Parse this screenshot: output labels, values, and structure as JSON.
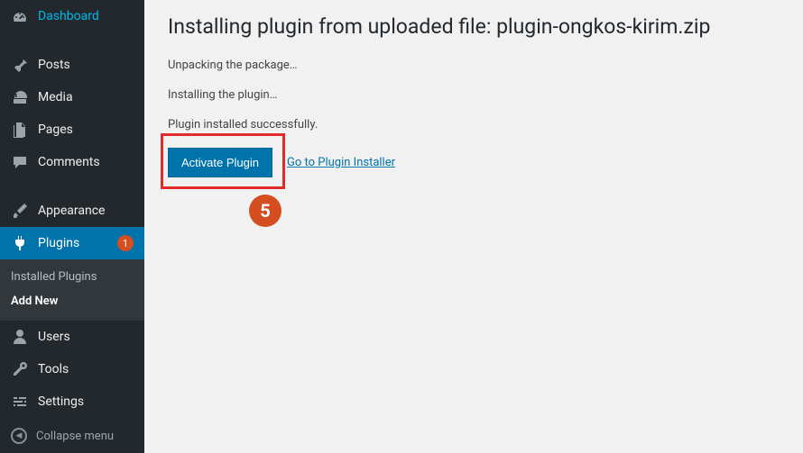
{
  "sidebar": {
    "items": [
      {
        "key": "dashboard",
        "label": "Dashboard",
        "icon": "dashboard"
      },
      {
        "key": "posts",
        "label": "Posts",
        "icon": "pin"
      },
      {
        "key": "media",
        "label": "Media",
        "icon": "media"
      },
      {
        "key": "pages",
        "label": "Pages",
        "icon": "pages"
      },
      {
        "key": "comments",
        "label": "Comments",
        "icon": "comment"
      },
      {
        "key": "appearance",
        "label": "Appearance",
        "icon": "brush"
      },
      {
        "key": "plugins",
        "label": "Plugins",
        "icon": "plug",
        "badge": "1",
        "active": true
      },
      {
        "key": "users",
        "label": "Users",
        "icon": "user"
      },
      {
        "key": "tools",
        "label": "Tools",
        "icon": "wrench"
      },
      {
        "key": "settings",
        "label": "Settings",
        "icon": "sliders"
      }
    ],
    "submenu": [
      {
        "label": "Installed Plugins",
        "current": false
      },
      {
        "label": "Add New",
        "current": true
      }
    ],
    "collapse_label": "Collapse menu"
  },
  "page": {
    "heading": "Installing plugin from uploaded file: plugin-ongkos-kirim.zip",
    "messages": [
      "Unpacking the package…",
      "Installing the plugin…",
      "Plugin installed successfully."
    ],
    "activate_btn": "Activate Plugin",
    "installer_link": "Go to Plugin Installer",
    "annotation_number": "5"
  }
}
